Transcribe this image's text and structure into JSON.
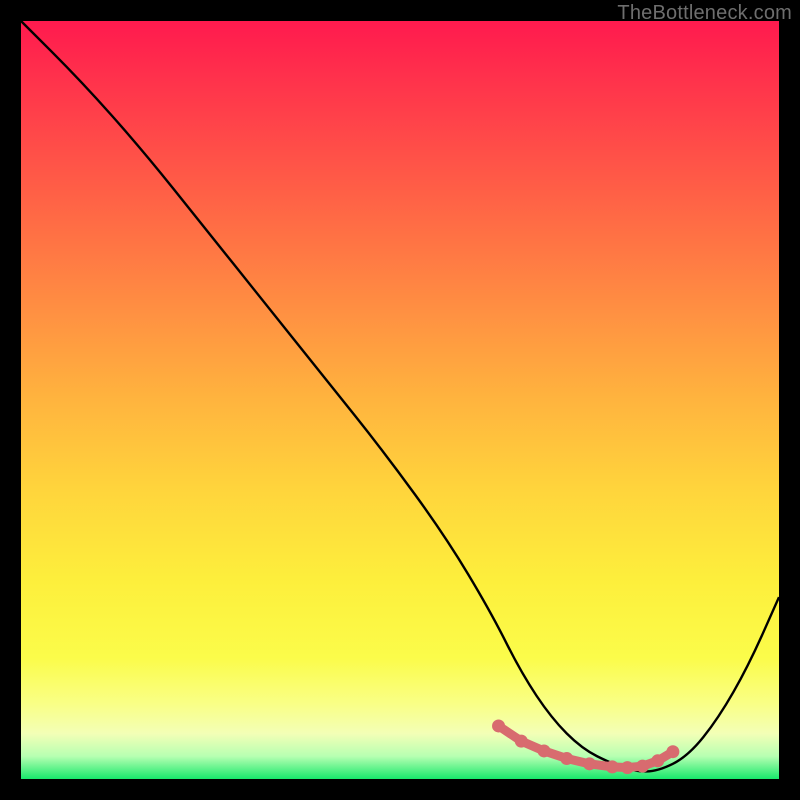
{
  "watermark": "TheBottleneck.com",
  "chart_data": {
    "type": "line",
    "title": "",
    "xlabel": "",
    "ylabel": "",
    "xlim": [
      0,
      100
    ],
    "ylim": [
      0,
      100
    ],
    "series": [
      {
        "name": "bottleneck-curve",
        "x": [
          0,
          8,
          16,
          24,
          32,
          40,
          48,
          56,
          62,
          66,
          70,
          74,
          78,
          81,
          84,
          88,
          92,
          96,
          100
        ],
        "values": [
          100,
          92,
          83,
          73,
          63,
          53,
          43,
          32,
          22,
          14,
          8,
          4,
          2,
          1,
          1,
          3,
          8,
          15,
          24
        ]
      }
    ],
    "highlight_segment": {
      "name": "valley-highlight",
      "x": [
        63,
        66,
        69,
        72,
        75,
        78,
        80,
        82,
        84,
        86
      ],
      "values": [
        7,
        5,
        3.7,
        2.7,
        2.0,
        1.6,
        1.5,
        1.7,
        2.4,
        3.6
      ]
    },
    "colors": {
      "curve": "#000000",
      "highlight": "#d86b6f",
      "gradient_top": "#ff1a4e",
      "gradient_bottom": "#17e86b"
    }
  }
}
